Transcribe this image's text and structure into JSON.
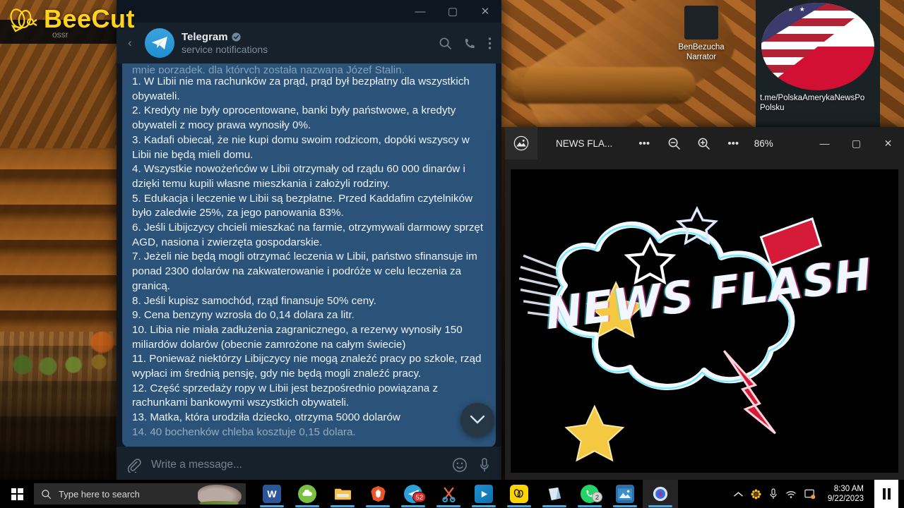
{
  "watermark": {
    "brand": "BeeCut",
    "icon": "bee-logo-icon"
  },
  "background_window": {
    "title": "ossr"
  },
  "desktop": {
    "icons": [
      {
        "label_line1": "BenBezucha",
        "label_line2": "Narrator",
        "icon": "narrator-thumbnail"
      }
    ],
    "channel_tile": {
      "label_line1": "t.me/PolskaAmerykaNewsPo",
      "label_line2": "Polsku",
      "icon": "usa-poland-flag-icon",
      "stars": "★ ★ ★ ★"
    }
  },
  "telegram": {
    "window_controls": {
      "minimize": "—",
      "maximize": "▢",
      "close": "✕"
    },
    "back_icon": "back-arrow-icon",
    "chat_name": "Telegram",
    "verified_icon": "verified-badge-icon",
    "chat_subtitle": "service notifications",
    "header_icons": {
      "search": "search-icon",
      "call": "phone-icon",
      "menu": "more-vertical-icon"
    },
    "message": {
      "clipped_top_line": "mnie porządek, dla których została nazwana Józef Stalin.",
      "lines": [
        "1. W Libii nie ma rachunków za prąd, prąd był bezpłatny dla wszystkich obywateli.",
        "2. Kredyty nie były oprocentowane, banki były państwowe, a kredyty obywateli z mocy prawa wynosiły 0%.",
        "3. Kadafi obiecał, że nie kupi domu swoim rodzicom, dopóki wszyscy w Libii nie będą mieli domu.",
        "4. Wszystkie nowożeńców w Libii otrzymały od rządu 60 000 dinarów i dzięki temu kupili własne mieszkania i założyli rodziny.",
        "5. Edukacja i leczenie w Libii są bezpłatne. Przed Kaddafim czytelników było zaledwie 25%, za jego panowania 83%.",
        "6. Jeśli Libijczycy chcieli mieszkać na farmie, otrzymywali darmowy sprzęt AGD, nasiona i zwierzęta gospodarskie.",
        "7. Jeżeli nie będą mogli otrzymać leczenia w Libii, państwo sfinansuje im ponad 2300 dolarów na zakwaterowanie i podróże w celu leczenia za granicą.",
        "8. Jeśli kupisz samochód, rząd finansuje 50% ceny.",
        "9. Cena benzyny wzrosła do 0,14 dolara za litr.",
        "10. Libia nie miała zadłużenia zagranicznego, a rezerwy wynosiły 150 miliardów dolarów (obecnie zamrożone na całym świecie)",
        "11. Ponieważ niektórzy Libijczycy nie mogą znaleźć pracy po szkole, rząd wypłaci im średnią pensję, gdy nie będą mogli znaleźć pracy.",
        "12. Część sprzedaży ropy w Libii jest bezpośrednio powiązana z rachunkami bankowymi wszystkich obywateli.",
        "13. Matka, która urodziła dziecko, otrzyma 5000 dolarów"
      ],
      "clipped_bottom_line": "14. 40 bochenków chleba kosztuje 0,15 dolara."
    },
    "scroll_down_icon": "chevron-down-icon",
    "composer": {
      "attach_icon": "paperclip-icon",
      "placeholder": "Write a message...",
      "emoji_icon": "smiley-icon",
      "mic_icon": "microphone-icon"
    }
  },
  "photos_viewer": {
    "app_icon": "photos-app-icon",
    "title": "NEWS FLA...",
    "toolbar": {
      "more_left": "•••",
      "zoom_out_icon": "zoom-out-icon",
      "zoom_in_icon": "zoom-in-icon",
      "more_right": "•••",
      "zoom_level": "86%"
    },
    "window_controls": {
      "minimize": "—",
      "maximize": "▢",
      "close": "✕"
    },
    "image": {
      "text": "NEWS FLASH",
      "alt": "news-flash-retro-graphic"
    }
  },
  "taskbar": {
    "start_icon": "windows-start-icon",
    "search": {
      "icon": "search-icon",
      "placeholder": "Type here to search"
    },
    "apps": [
      {
        "name": "word",
        "label": "W",
        "badge": null,
        "active": false
      },
      {
        "name": "mega",
        "label": "",
        "badge": null,
        "active": false
      },
      {
        "name": "file-explorer",
        "label": "",
        "badge": null,
        "active": false
      },
      {
        "name": "brave",
        "label": "",
        "badge": null,
        "active": false
      },
      {
        "name": "telegram",
        "label": "",
        "badge": "52",
        "active": false
      },
      {
        "name": "snipping-tool",
        "label": "",
        "badge": null,
        "active": false
      },
      {
        "name": "movies-tv",
        "label": "",
        "badge": null,
        "active": false
      },
      {
        "name": "beecut",
        "label": "",
        "badge": null,
        "active": false
      },
      {
        "name": "sticky-notes",
        "label": "",
        "badge": null,
        "active": false
      },
      {
        "name": "whatsapp",
        "label": "",
        "badge": "2",
        "active": false
      },
      {
        "name": "photos",
        "label": "",
        "badge": null,
        "active": false
      },
      {
        "name": "loading-app",
        "label": "",
        "badge": null,
        "active": true
      }
    ],
    "tray": {
      "expand_icon": "chevron-up-icon",
      "sunflower_icon": "sunflower-icon",
      "mic_icon": "microphone-icon",
      "wifi_icon": "wifi-icon",
      "action_center_icon": "action-center-icon",
      "time": "8:30 AM",
      "date": "9/22/2023"
    },
    "pause_button": "pause-icon"
  }
}
